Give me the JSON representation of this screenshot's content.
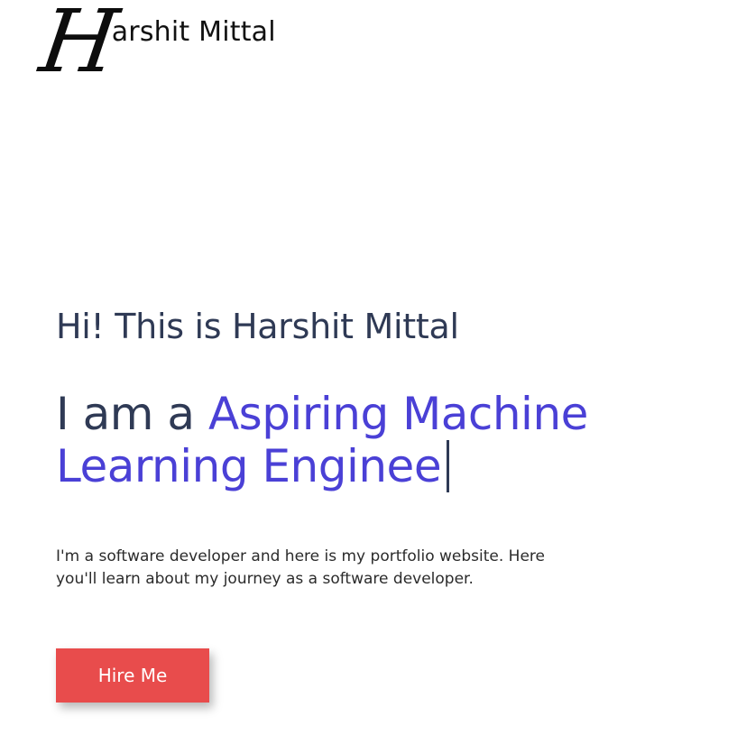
{
  "header": {
    "logo_mark": "H",
    "logo_text": "arshit Mittal"
  },
  "hero": {
    "greeting": "Hi! This is Harshit Mittal",
    "headline_prefix": "I am a",
    "headline_role": "Aspiring Machine Learning Enginee",
    "intro": "I'm a software developer and here is my portfolio website. Here you'll learn about my journey as a software developer.",
    "hire_button_label": "Hire Me"
  },
  "colors": {
    "accent": "#4a40d6",
    "heading": "#2f3a55",
    "button": "#e84c4c",
    "background": "#ffffff"
  }
}
